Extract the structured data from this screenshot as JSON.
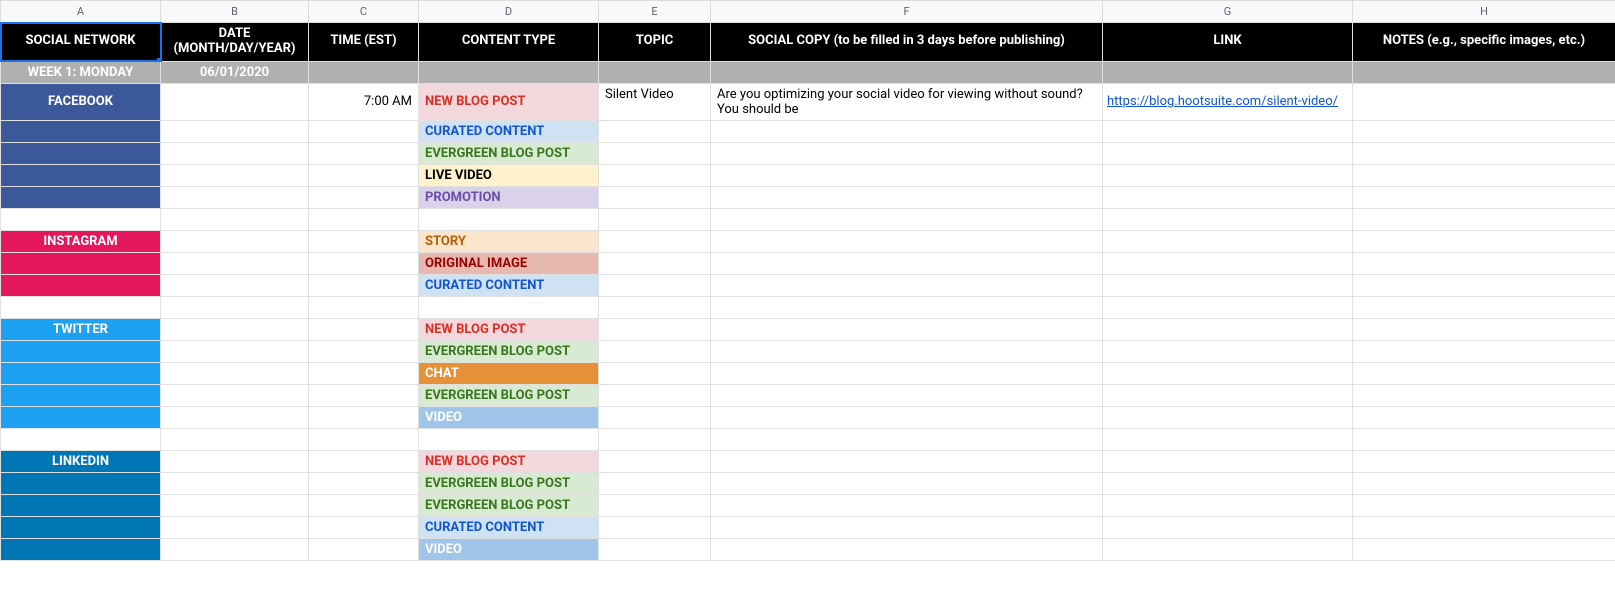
{
  "columns": [
    "A",
    "B",
    "C",
    "D",
    "E",
    "F",
    "G",
    "H"
  ],
  "headers": {
    "A": "SOCIAL NETWORK",
    "B": "DATE (MONTH/DAY/YEAR)",
    "C": "TIME (EST)",
    "D": "CONTENT TYPE",
    "E": "TOPIC",
    "F": "SOCIAL COPY (to be filled in 3 days before publishing)",
    "G": "LINK",
    "H": "NOTES (e.g., specific images, etc.)"
  },
  "week": {
    "label": "WEEK 1: MONDAY",
    "date": "06/01/2020"
  },
  "rows": [
    {
      "net": "FACEBOOK",
      "netcls": "fb",
      "time": "7:00 AM",
      "ct": "NEW BLOG POST",
      "ctcls": "ct-newblog",
      "topic": "Silent Video",
      "copy": "Are you optimizing your social video for viewing without sound? You should be",
      "link": "https://blog.hootsuite.com/silent-video/"
    },
    {
      "netcls": "fb",
      "ct": "CURATED CONTENT",
      "ctcls": "ct-curated"
    },
    {
      "netcls": "fb",
      "ct": "EVERGREEN BLOG POST",
      "ctcls": "ct-evergreen"
    },
    {
      "netcls": "fb",
      "ct": "LIVE VIDEO",
      "ctcls": "ct-live"
    },
    {
      "netcls": "fb",
      "ct": "PROMOTION",
      "ctcls": "ct-promo"
    },
    {
      "spacer": true
    },
    {
      "net": "INSTAGRAM",
      "netcls": "ig",
      "ct": "STORY",
      "ctcls": "ct-story"
    },
    {
      "netcls": "ig",
      "ct": "ORIGINAL IMAGE",
      "ctcls": "ct-origimg"
    },
    {
      "netcls": "ig",
      "ct": "CURATED CONTENT",
      "ctcls": "ct-curated"
    },
    {
      "spacer": true
    },
    {
      "net": "TWITTER",
      "netcls": "tw",
      "ct": "NEW BLOG POST",
      "ctcls": "ct-newblog"
    },
    {
      "netcls": "tw",
      "ct": "EVERGREEN BLOG POST",
      "ctcls": "ct-evergreen"
    },
    {
      "netcls": "tw",
      "ct": "CHAT",
      "ctcls": "ct-chat"
    },
    {
      "netcls": "tw",
      "ct": "EVERGREEN BLOG POST",
      "ctcls": "ct-evergreen"
    },
    {
      "netcls": "tw",
      "ct": "VIDEO",
      "ctcls": "ct-video"
    },
    {
      "spacer": true
    },
    {
      "net": "LINKEDIN",
      "netcls": "li",
      "ct": "NEW BLOG POST",
      "ctcls": "ct-newblog"
    },
    {
      "netcls": "li",
      "ct": "EVERGREEN BLOG POST",
      "ctcls": "ct-evergreen"
    },
    {
      "netcls": "li",
      "ct": "EVERGREEN BLOG POST",
      "ctcls": "ct-evergreen"
    },
    {
      "netcls": "li",
      "ct": "CURATED CONTENT",
      "ctcls": "ct-curated"
    },
    {
      "netcls": "li",
      "ct": "VIDEO",
      "ctcls": "ct-video"
    }
  ]
}
